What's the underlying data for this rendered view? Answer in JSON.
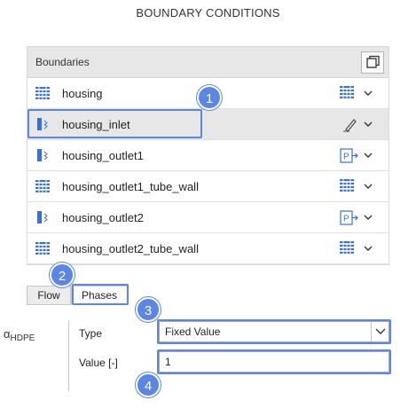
{
  "title": "BOUNDARY CONDITIONS",
  "boundaries": {
    "header_label": "Boundaries",
    "copy_icon": "copy-icon",
    "rows": [
      {
        "name": "housing",
        "type_icon": "wall-icon",
        "bc_icon": "wall-icon",
        "selected": false
      },
      {
        "name": "housing_inlet",
        "type_icon": "inlet-icon",
        "bc_icon": "pencil-icon",
        "selected": true
      },
      {
        "name": "housing_outlet1",
        "type_icon": "inlet-icon",
        "bc_icon": "pressure-outlet-icon",
        "selected": false
      },
      {
        "name": "housing_outlet1_tube_wall",
        "type_icon": "wall-icon",
        "bc_icon": "wall-icon",
        "selected": false
      },
      {
        "name": "housing_outlet2",
        "type_icon": "inlet-icon",
        "bc_icon": "pressure-outlet-icon",
        "selected": false
      },
      {
        "name": "housing_outlet2_tube_wall",
        "type_icon": "wall-icon",
        "bc_icon": "wall-icon",
        "selected": false
      }
    ]
  },
  "tabs": [
    {
      "label": "Flow",
      "active": false
    },
    {
      "label": "Phases",
      "active": true
    }
  ],
  "phase": {
    "symbol": "α",
    "subscript": "HDPE",
    "type_label": "Type",
    "type_value": "Fixed Value",
    "value_label": "Value [-]",
    "value": "1"
  },
  "callouts": [
    "1",
    "2",
    "3",
    "4"
  ],
  "colors": {
    "accent": "#5b86e5",
    "icon_blue": "#3a6fd8",
    "header_bg": "#e7e7e7",
    "selected_bg": "#e7e7e7"
  }
}
